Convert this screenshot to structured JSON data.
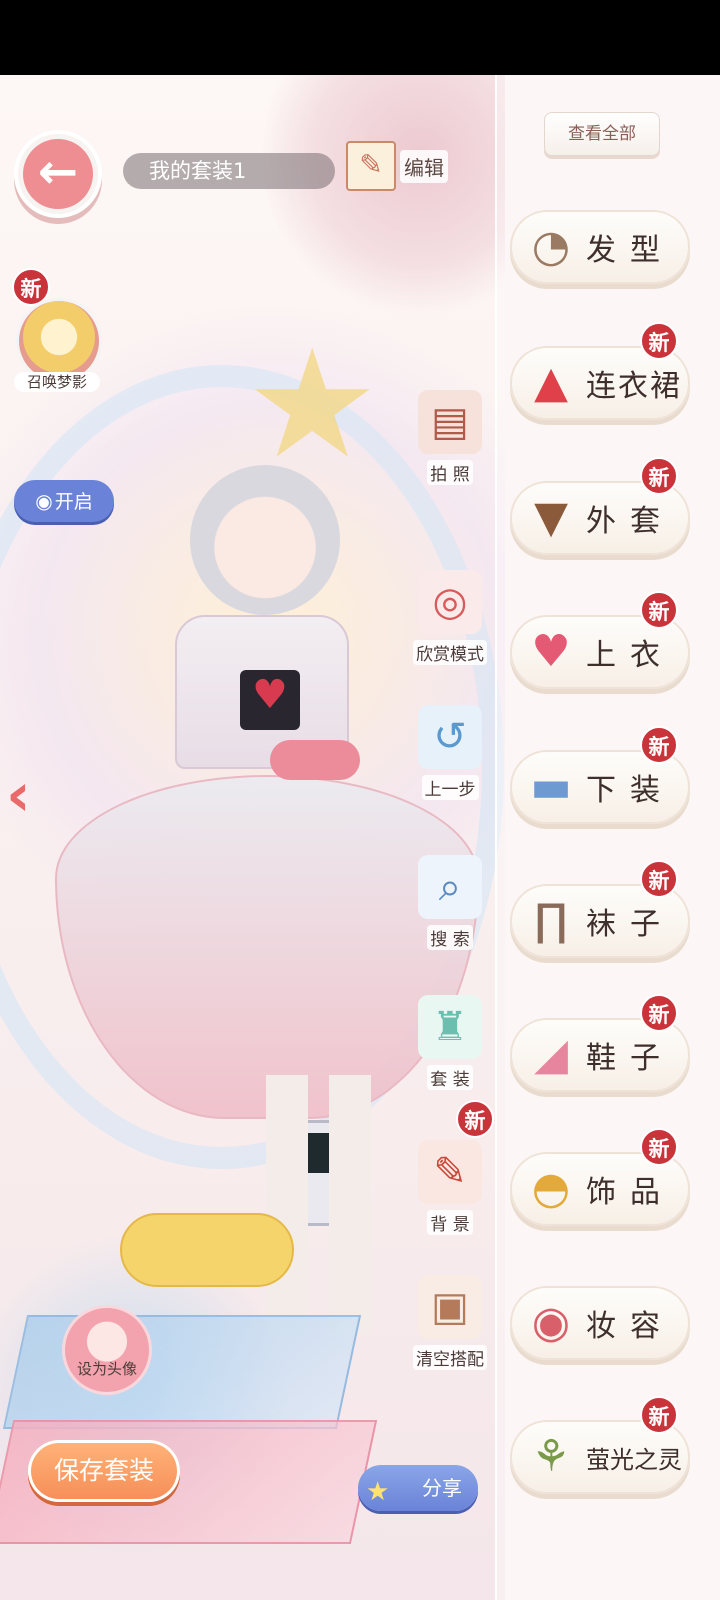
{
  "header": {
    "outfit_name": "我的套装1",
    "edit_label": "编辑"
  },
  "left_controls": {
    "new_label": "新",
    "summon_label": "召唤梦影",
    "toggle_label": "开启",
    "set_avatar_label": "设为头像",
    "save_label": "保存套装",
    "share_label": "分享"
  },
  "tools": [
    {
      "label": "拍 照",
      "icon": "album-camera-icon"
    },
    {
      "label": "欣赏模式",
      "icon": "camera-icon"
    },
    {
      "label": "上一步",
      "icon": "undo-shirt-icon"
    },
    {
      "label": "搜 索",
      "icon": "magnifier-icon"
    },
    {
      "label": "套 装",
      "icon": "outfit-icon"
    },
    {
      "label": "背 景",
      "icon": "paintbrush-icon",
      "new": "新"
    },
    {
      "label": "清空搭配",
      "icon": "clear-box-icon"
    }
  ],
  "categories": {
    "view_all": "查看全部",
    "items": [
      {
        "label": "发型",
        "icon": "hair-icon",
        "new": ""
      },
      {
        "label": "连衣裙",
        "icon": "dress-icon",
        "new": "新"
      },
      {
        "label": "外套",
        "icon": "coat-icon",
        "new": "新"
      },
      {
        "label": "上衣",
        "icon": "shirt-icon",
        "new": "新"
      },
      {
        "label": "下装",
        "icon": "shorts-icon",
        "new": "新"
      },
      {
        "label": "袜子",
        "icon": "socks-icon",
        "new": "新"
      },
      {
        "label": "鞋子",
        "icon": "heels-icon",
        "new": "新"
      },
      {
        "label": "饰品",
        "icon": "hat-icon",
        "new": "新"
      },
      {
        "label": "妆容",
        "icon": "compact-icon",
        "new": ""
      },
      {
        "label": "萤光之灵",
        "icon": "branch-icon",
        "new": "新"
      }
    ]
  },
  "colors": {
    "accent_pink": "#ef8e92",
    "badge_red": "#c9343b",
    "button_blue": "#6a83d8",
    "save_orange": "#f68d57"
  }
}
